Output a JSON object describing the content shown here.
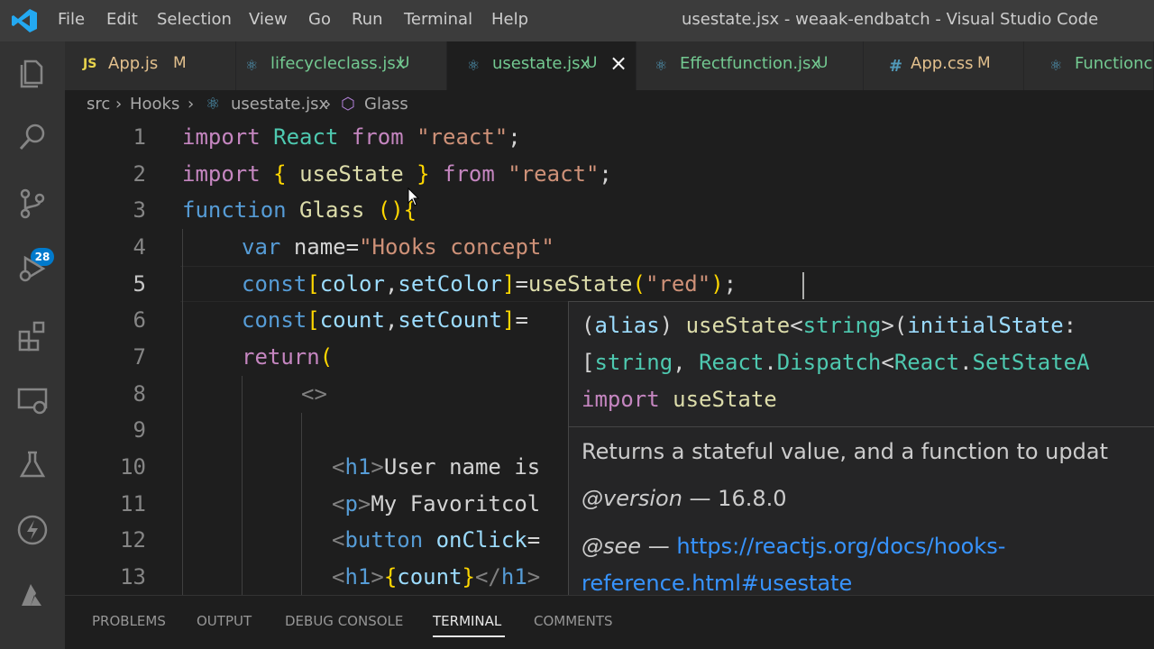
{
  "window": {
    "title": "usestate.jsx - weaak-endbatch - Visual Studio Code",
    "menu": [
      "File",
      "Edit",
      "Selection",
      "View",
      "Go",
      "Run",
      "Terminal",
      "Help"
    ]
  },
  "activity_bar": {
    "items": [
      "files-icon",
      "search-icon",
      "source-control-icon",
      "run-debug-icon",
      "extensions-icon",
      "remote-explorer-icon",
      "testing-icon",
      "thunder-icon",
      "azure-icon"
    ],
    "scm_badge": "28"
  },
  "tabs": [
    {
      "icon": "JS",
      "label": "App.js",
      "status": "M",
      "active": false
    },
    {
      "icon": "react-icon",
      "label": "lifecycleclass.jsx",
      "status": "U",
      "active": false
    },
    {
      "icon": "react-icon",
      "label": "usestate.jsx",
      "status": "U",
      "active": true
    },
    {
      "icon": "react-icon",
      "label": "Effectfunction.jsx",
      "status": "U",
      "active": false
    },
    {
      "icon": "#",
      "label": "App.css",
      "status": "M",
      "active": false
    },
    {
      "icon": "react-icon",
      "label": "Functionco",
      "status": "",
      "active": false
    }
  ],
  "breadcrumb": [
    "src",
    "Hooks",
    "usestate.jsx",
    "Glass"
  ],
  "editor": {
    "line_numbers": [
      "1",
      "2",
      "3",
      "4",
      "5",
      "6",
      "7",
      "8",
      "9",
      "10",
      "11",
      "12",
      "13"
    ],
    "current_line": "5",
    "lines": [
      "import React from \"react\";",
      "import { useState } from \"react\";",
      "function Glass (){",
      "var name=\"Hooks concept\"",
      "const[color,setColor]=useState(\"red\");",
      "const[count,setCount]=",
      "return(",
      "<>",
      "",
      "<h1>User name is",
      "<p>My Favoritcol",
      "<button onClick=",
      "<h1>{count}</h1>"
    ]
  },
  "hover": {
    "signature_line1": "(alias) useState<string>(initialState:",
    "signature_line2": "[string, React.Dispatch<React.SetStateA",
    "import_line": "import useState",
    "description": "Returns a stateful value, and a function to updat",
    "version_tag": "@version",
    "version_value": "— 16.8.0",
    "see_tag": "@see",
    "see_dash": "—",
    "see_link_line1": "https://reactjs.org/docs/hooks-",
    "see_link_line2": "reference.html#usestate"
  },
  "panel_tabs": [
    {
      "label": "PROBLEMS",
      "active": false
    },
    {
      "label": "OUTPUT",
      "active": false
    },
    {
      "label": "DEBUG CONSOLE",
      "active": false
    },
    {
      "label": "TERMINAL",
      "active": true
    },
    {
      "label": "COMMENTS",
      "active": false
    }
  ],
  "colors": {
    "accent": "#007acc",
    "link": "#3794ff",
    "modified": "#e2c08d",
    "untracked": "#73c991"
  }
}
